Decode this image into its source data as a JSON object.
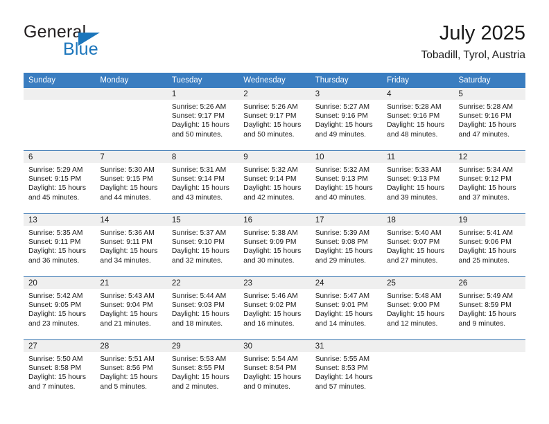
{
  "logo": {
    "word_top": "General",
    "word_bottom": "Blue",
    "triangle_color": "#1b75bb",
    "text_color": "#231f20",
    "blue_color": "#1b75bb"
  },
  "header": {
    "title": "July 2025",
    "location": "Tobadill, Tyrol, Austria"
  },
  "theme": {
    "header_bg": "#3a7dc0",
    "row_divider": "#2f6fad",
    "daynum_band": "#efefef"
  },
  "weekday_headers": [
    "Sunday",
    "Monday",
    "Tuesday",
    "Wednesday",
    "Thursday",
    "Friday",
    "Saturday"
  ],
  "weeks": [
    [
      {
        "day": "",
        "sunrise": "",
        "sunset": "",
        "daylight_line1": "",
        "daylight_line2": ""
      },
      {
        "day": "",
        "sunrise": "",
        "sunset": "",
        "daylight_line1": "",
        "daylight_line2": ""
      },
      {
        "day": "1",
        "sunrise": "Sunrise: 5:26 AM",
        "sunset": "Sunset: 9:17 PM",
        "daylight_line1": "Daylight: 15 hours",
        "daylight_line2": "and 50 minutes."
      },
      {
        "day": "2",
        "sunrise": "Sunrise: 5:26 AM",
        "sunset": "Sunset: 9:17 PM",
        "daylight_line1": "Daylight: 15 hours",
        "daylight_line2": "and 50 minutes."
      },
      {
        "day": "3",
        "sunrise": "Sunrise: 5:27 AM",
        "sunset": "Sunset: 9:16 PM",
        "daylight_line1": "Daylight: 15 hours",
        "daylight_line2": "and 49 minutes."
      },
      {
        "day": "4",
        "sunrise": "Sunrise: 5:28 AM",
        "sunset": "Sunset: 9:16 PM",
        "daylight_line1": "Daylight: 15 hours",
        "daylight_line2": "and 48 minutes."
      },
      {
        "day": "5",
        "sunrise": "Sunrise: 5:28 AM",
        "sunset": "Sunset: 9:16 PM",
        "daylight_line1": "Daylight: 15 hours",
        "daylight_line2": "and 47 minutes."
      }
    ],
    [
      {
        "day": "6",
        "sunrise": "Sunrise: 5:29 AM",
        "sunset": "Sunset: 9:15 PM",
        "daylight_line1": "Daylight: 15 hours",
        "daylight_line2": "and 45 minutes."
      },
      {
        "day": "7",
        "sunrise": "Sunrise: 5:30 AM",
        "sunset": "Sunset: 9:15 PM",
        "daylight_line1": "Daylight: 15 hours",
        "daylight_line2": "and 44 minutes."
      },
      {
        "day": "8",
        "sunrise": "Sunrise: 5:31 AM",
        "sunset": "Sunset: 9:14 PM",
        "daylight_line1": "Daylight: 15 hours",
        "daylight_line2": "and 43 minutes."
      },
      {
        "day": "9",
        "sunrise": "Sunrise: 5:32 AM",
        "sunset": "Sunset: 9:14 PM",
        "daylight_line1": "Daylight: 15 hours",
        "daylight_line2": "and 42 minutes."
      },
      {
        "day": "10",
        "sunrise": "Sunrise: 5:32 AM",
        "sunset": "Sunset: 9:13 PM",
        "daylight_line1": "Daylight: 15 hours",
        "daylight_line2": "and 40 minutes."
      },
      {
        "day": "11",
        "sunrise": "Sunrise: 5:33 AM",
        "sunset": "Sunset: 9:13 PM",
        "daylight_line1": "Daylight: 15 hours",
        "daylight_line2": "and 39 minutes."
      },
      {
        "day": "12",
        "sunrise": "Sunrise: 5:34 AM",
        "sunset": "Sunset: 9:12 PM",
        "daylight_line1": "Daylight: 15 hours",
        "daylight_line2": "and 37 minutes."
      }
    ],
    [
      {
        "day": "13",
        "sunrise": "Sunrise: 5:35 AM",
        "sunset": "Sunset: 9:11 PM",
        "daylight_line1": "Daylight: 15 hours",
        "daylight_line2": "and 36 minutes."
      },
      {
        "day": "14",
        "sunrise": "Sunrise: 5:36 AM",
        "sunset": "Sunset: 9:11 PM",
        "daylight_line1": "Daylight: 15 hours",
        "daylight_line2": "and 34 minutes."
      },
      {
        "day": "15",
        "sunrise": "Sunrise: 5:37 AM",
        "sunset": "Sunset: 9:10 PM",
        "daylight_line1": "Daylight: 15 hours",
        "daylight_line2": "and 32 minutes."
      },
      {
        "day": "16",
        "sunrise": "Sunrise: 5:38 AM",
        "sunset": "Sunset: 9:09 PM",
        "daylight_line1": "Daylight: 15 hours",
        "daylight_line2": "and 30 minutes."
      },
      {
        "day": "17",
        "sunrise": "Sunrise: 5:39 AM",
        "sunset": "Sunset: 9:08 PM",
        "daylight_line1": "Daylight: 15 hours",
        "daylight_line2": "and 29 minutes."
      },
      {
        "day": "18",
        "sunrise": "Sunrise: 5:40 AM",
        "sunset": "Sunset: 9:07 PM",
        "daylight_line1": "Daylight: 15 hours",
        "daylight_line2": "and 27 minutes."
      },
      {
        "day": "19",
        "sunrise": "Sunrise: 5:41 AM",
        "sunset": "Sunset: 9:06 PM",
        "daylight_line1": "Daylight: 15 hours",
        "daylight_line2": "and 25 minutes."
      }
    ],
    [
      {
        "day": "20",
        "sunrise": "Sunrise: 5:42 AM",
        "sunset": "Sunset: 9:05 PM",
        "daylight_line1": "Daylight: 15 hours",
        "daylight_line2": "and 23 minutes."
      },
      {
        "day": "21",
        "sunrise": "Sunrise: 5:43 AM",
        "sunset": "Sunset: 9:04 PM",
        "daylight_line1": "Daylight: 15 hours",
        "daylight_line2": "and 21 minutes."
      },
      {
        "day": "22",
        "sunrise": "Sunrise: 5:44 AM",
        "sunset": "Sunset: 9:03 PM",
        "daylight_line1": "Daylight: 15 hours",
        "daylight_line2": "and 18 minutes."
      },
      {
        "day": "23",
        "sunrise": "Sunrise: 5:46 AM",
        "sunset": "Sunset: 9:02 PM",
        "daylight_line1": "Daylight: 15 hours",
        "daylight_line2": "and 16 minutes."
      },
      {
        "day": "24",
        "sunrise": "Sunrise: 5:47 AM",
        "sunset": "Sunset: 9:01 PM",
        "daylight_line1": "Daylight: 15 hours",
        "daylight_line2": "and 14 minutes."
      },
      {
        "day": "25",
        "sunrise": "Sunrise: 5:48 AM",
        "sunset": "Sunset: 9:00 PM",
        "daylight_line1": "Daylight: 15 hours",
        "daylight_line2": "and 12 minutes."
      },
      {
        "day": "26",
        "sunrise": "Sunrise: 5:49 AM",
        "sunset": "Sunset: 8:59 PM",
        "daylight_line1": "Daylight: 15 hours",
        "daylight_line2": "and 9 minutes."
      }
    ],
    [
      {
        "day": "27",
        "sunrise": "Sunrise: 5:50 AM",
        "sunset": "Sunset: 8:58 PM",
        "daylight_line1": "Daylight: 15 hours",
        "daylight_line2": "and 7 minutes."
      },
      {
        "day": "28",
        "sunrise": "Sunrise: 5:51 AM",
        "sunset": "Sunset: 8:56 PM",
        "daylight_line1": "Daylight: 15 hours",
        "daylight_line2": "and 5 minutes."
      },
      {
        "day": "29",
        "sunrise": "Sunrise: 5:53 AM",
        "sunset": "Sunset: 8:55 PM",
        "daylight_line1": "Daylight: 15 hours",
        "daylight_line2": "and 2 minutes."
      },
      {
        "day": "30",
        "sunrise": "Sunrise: 5:54 AM",
        "sunset": "Sunset: 8:54 PM",
        "daylight_line1": "Daylight: 15 hours",
        "daylight_line2": "and 0 minutes."
      },
      {
        "day": "31",
        "sunrise": "Sunrise: 5:55 AM",
        "sunset": "Sunset: 8:53 PM",
        "daylight_line1": "Daylight: 14 hours",
        "daylight_line2": "and 57 minutes."
      },
      {
        "day": "",
        "sunrise": "",
        "sunset": "",
        "daylight_line1": "",
        "daylight_line2": ""
      },
      {
        "day": "",
        "sunrise": "",
        "sunset": "",
        "daylight_line1": "",
        "daylight_line2": ""
      }
    ]
  ]
}
